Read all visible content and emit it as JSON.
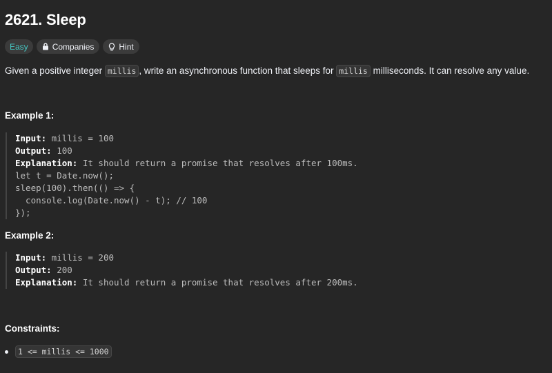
{
  "problem": {
    "title": "2621. Sleep",
    "difficulty": "Easy",
    "companies_label": "Companies",
    "hint_label": "Hint",
    "description": {
      "part1": "Given a positive integer ",
      "code1": "millis",
      "part2": ", write an asynchronous function that sleeps for ",
      "code2": "millis",
      "part3": " milliseconds. It can resolve any value."
    }
  },
  "examples": [
    {
      "heading": "Example 1:",
      "input_label": "Input:",
      "input_value": " millis = 100",
      "output_label": "Output:",
      "output_value": " 100",
      "explanation_label": "Explanation:",
      "explanation_lines": [
        " It should return a promise that resolves after 100ms.",
        "let t = Date.now();",
        "sleep(100).then(() => {",
        "  console.log(Date.now() - t); // 100",
        "});"
      ]
    },
    {
      "heading": "Example 2:",
      "input_label": "Input:",
      "input_value": " millis = 200",
      "output_label": "Output:",
      "output_value": " 200",
      "explanation_label": "Explanation:",
      "explanation_lines": [
        " It should return a promise that resolves after 200ms."
      ]
    }
  ],
  "constraints": {
    "heading": "Constraints:",
    "items": [
      "1 <= millis <= 1000"
    ]
  },
  "colors": {
    "background": "#262626",
    "easy": "#46c6c2",
    "tag_bg": "#3b3b3b"
  }
}
